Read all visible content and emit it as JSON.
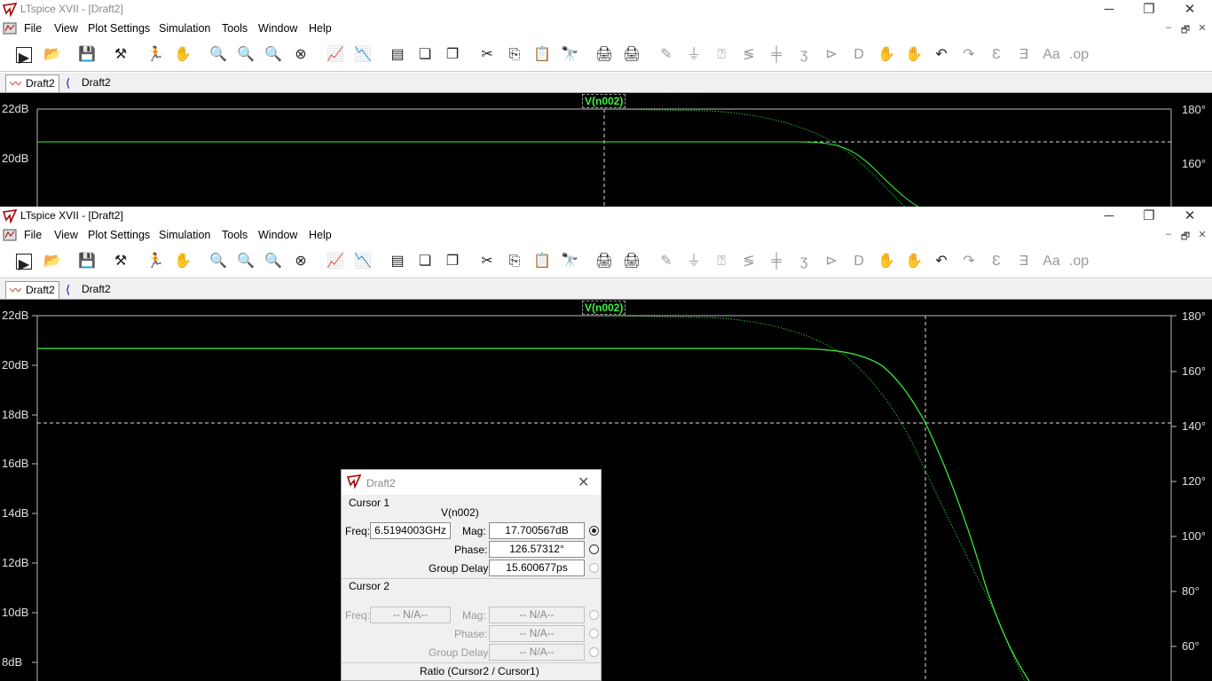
{
  "window": {
    "title": "LTspice XVII - [Draft2]",
    "menu": [
      "File",
      "View",
      "Plot Settings",
      "Simulation",
      "Tools",
      "Window",
      "Help"
    ],
    "tabs": [
      {
        "label": "Draft2",
        "kind": "waveform",
        "active": true
      },
      {
        "label": "Draft2",
        "kind": "schematic",
        "active": false
      }
    ]
  },
  "plot": {
    "trace_name": "V(n002)",
    "trace_color": "#3cf23c",
    "left_axis": [
      "22dB",
      "20dB",
      "18dB",
      "16dB",
      "14dB",
      "12dB",
      "10dB",
      "8dB"
    ],
    "right_axis": [
      "180°",
      "160°",
      "140°",
      "120°",
      "100°",
      "80°",
      "60°"
    ]
  },
  "dialog": {
    "title": "Draft2",
    "cursor1": {
      "heading": "Cursor 1",
      "trace": "V(n002)",
      "freq_label": "Freq:",
      "freq": "6.5194003GHz",
      "mag_label": "Mag:",
      "mag": "17.700567dB",
      "phase_label": "Phase:",
      "phase": "126.57312°",
      "gd_label": "Group Delay:",
      "group_delay": "15.600677ps"
    },
    "cursor2": {
      "heading": "Cursor 2",
      "freq_label": "Freq:",
      "freq": "-- N/A--",
      "mag_label": "Mag:",
      "mag": "-- N/A--",
      "phase_label": "Phase:",
      "phase": "-- N/A--",
      "gd_label": "Group Delay:",
      "group_delay": "-- N/A--"
    },
    "ratio_heading": "Ratio (Cursor2 / Cursor1)"
  }
}
